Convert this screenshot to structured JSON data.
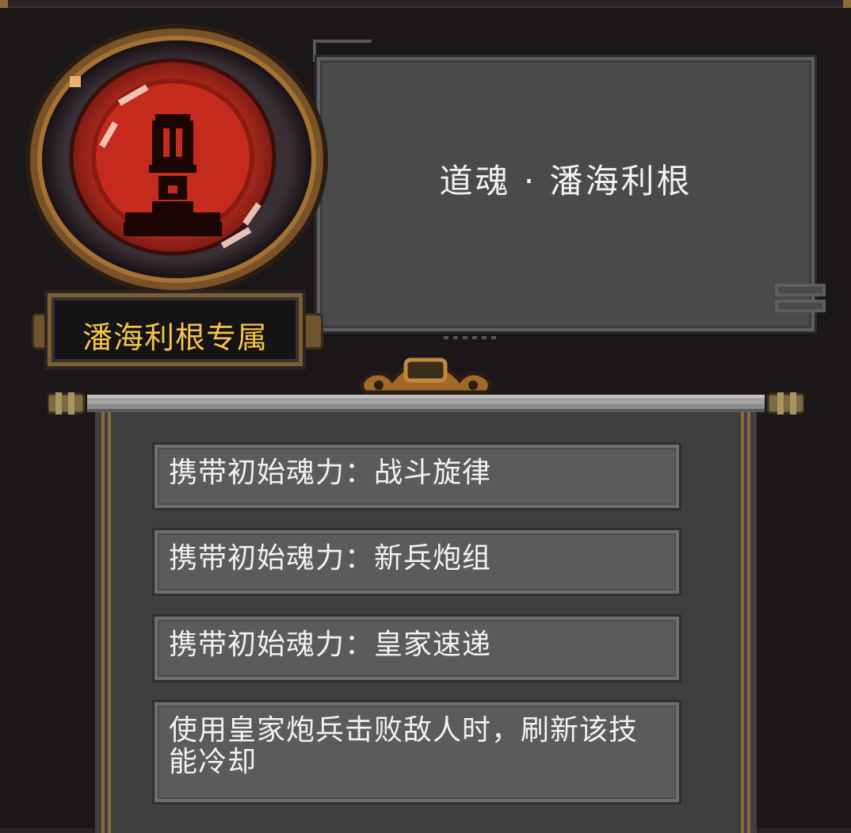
{
  "soul": {
    "name": "道魂 · 潘海利根",
    "exclusive_label": "潘海利根专属"
  },
  "abilities": [
    "携带初始魂力：战斗旋律",
    "携带初始魂力：新兵炮组",
    "携带初始魂力：皇家速递",
    "使用皇家炮兵击败敌人时，刷新该技能冷却"
  ],
  "colors": {
    "accent_gold": "#f4c44a",
    "portrait_red": "#d8352a",
    "frame_bronze": "#8b6a3a"
  },
  "icons": {
    "portrait": "masked-soldier-portrait-icon"
  }
}
